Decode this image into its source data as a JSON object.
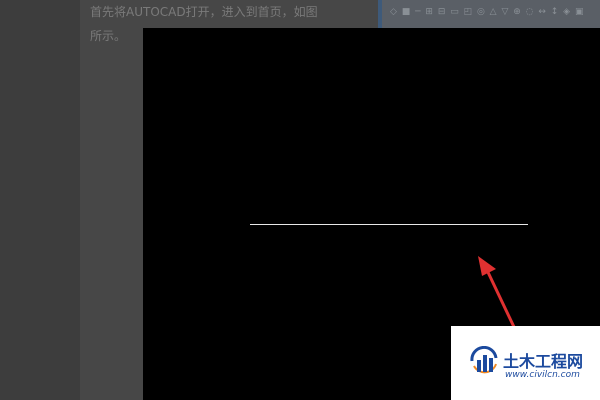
{
  "article": {
    "line1": "首先将AUTOCAD打开，进入到首页，如图",
    "line2": "所示。"
  },
  "toolbar": {
    "icons_text": "◇ ■ ─ ⊞ ⊟ ▭ ◰ ◎ △ ▽ ⊕ ◌ ↔ ↕ ◈ ▣"
  },
  "watermark": {
    "brand": "土木工程网",
    "url": "www.civilcn.com"
  },
  "colors": {
    "canvas": "#000000",
    "line": "#e8e8e8",
    "arrow": "#e03131",
    "brand": "#1c4a9e"
  }
}
